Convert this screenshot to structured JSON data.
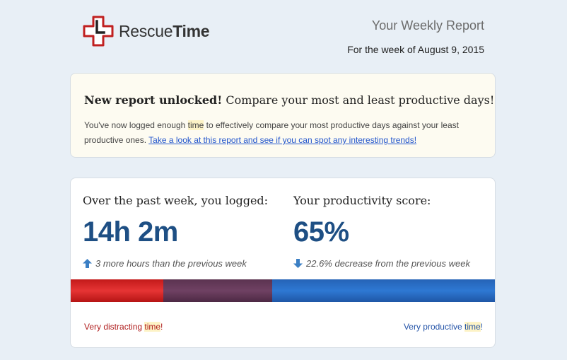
{
  "header": {
    "logo_text_light": "Rescue",
    "logo_text_bold": "Time",
    "report_title": "Your Weekly Report",
    "report_week": "For the week of August 9, 2015"
  },
  "unlock_card": {
    "heading_bold": "New report unlocked!",
    "heading_rest": " Compare your most and least productive days!",
    "body_before": "You've now logged enough ",
    "body_highlight": "time",
    "body_after": " to effectively compare your most productive days against your least productive ones. ",
    "link_text": "Take a look at this report and see if you can spot any interesting trends!"
  },
  "stats_card": {
    "logged": {
      "label": "Over the past week, you logged:",
      "value": "14h 2m",
      "change": "3 more hours than the previous week",
      "change_direction": "up"
    },
    "productivity": {
      "label": "Your productivity score:",
      "value": "65%",
      "change": "22.6% decrease from the previous week",
      "change_direction": "down"
    },
    "bar_label_left_before": "Very distracting ",
    "bar_label_left_highlight": "time",
    "bar_label_left_after": "!",
    "bar_label_right_before": "Very productive ",
    "bar_label_right_highlight": "time",
    "bar_label_right_after": "!"
  },
  "colors": {
    "accent_blue": "#1e4f84",
    "arrow_blue": "#3b7fc4",
    "distracting_red": "#b01e1e",
    "productive_blue": "#2554a8"
  }
}
